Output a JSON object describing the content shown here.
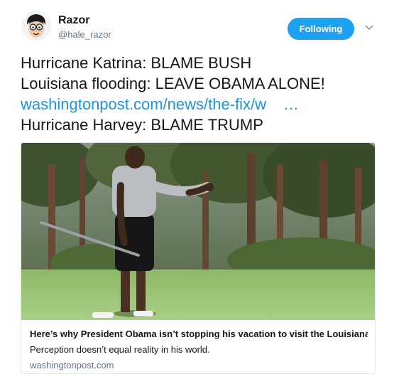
{
  "author": {
    "display_name": "Razor",
    "handle": "@hale_razor",
    "avatar_icon": "cartoon-avatar-icon"
  },
  "follow_button": {
    "label": "Following",
    "color": "#1da1f2"
  },
  "menu": {
    "icon": "chevron-down-icon"
  },
  "tweet": {
    "line1": "Hurricane Katrina: BLAME BUSH",
    "line2": "Louisiana flooding: LEAVE OBAMA ALONE!",
    "link_text": "washingtonpost.com/news/the-fix/w",
    "link_ellipsis": "…",
    "line4": "Hurricane Harvey: BLAME TRUMP",
    "link_color": "#1b95e0"
  },
  "card": {
    "title": "Here’s why President Obama isn’t stopping his vacation to visit the Louisiana…",
    "description": "Perception doesn’t equal reality in his world.",
    "domain": "washingtonpost.com"
  }
}
